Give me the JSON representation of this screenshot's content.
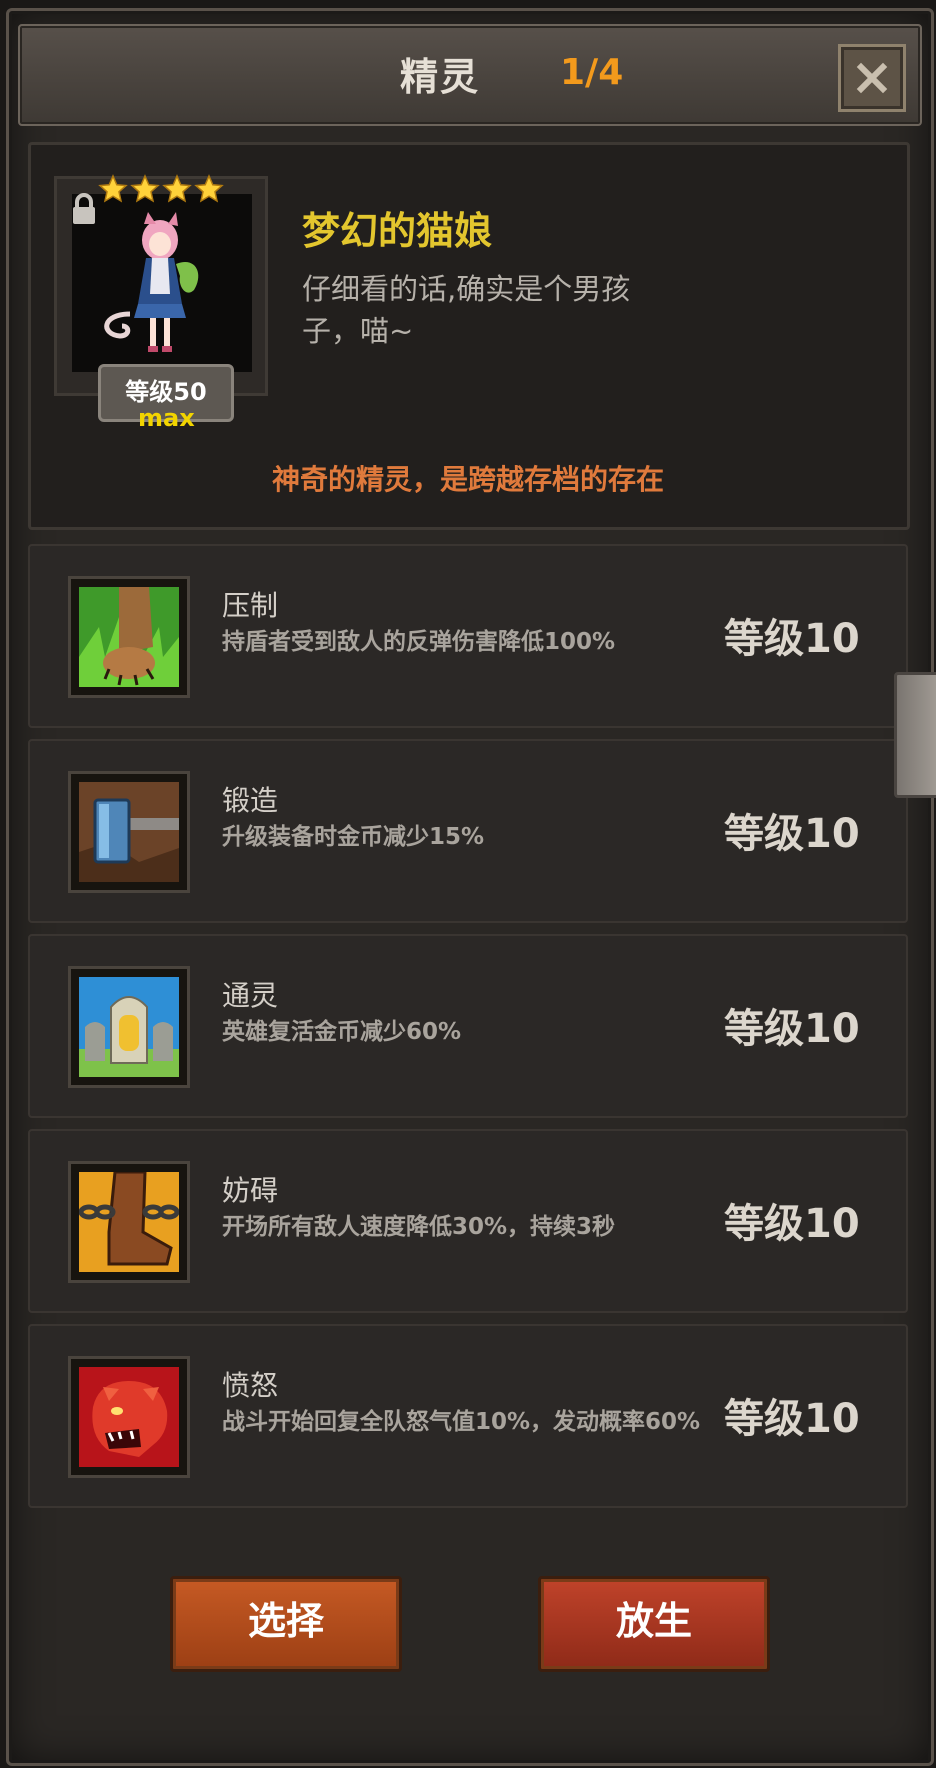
{
  "header": {
    "title": "精灵",
    "page_indicator": "1/4"
  },
  "spirit": {
    "name": "梦幻的猫娘",
    "description": "仔细看的话,确实是个男孩子，喵~",
    "stars": 4,
    "level_label": "等级50",
    "max_label": "max",
    "note": "神奇的精灵，是跨越存档的存在"
  },
  "skills": [
    {
      "name": "压制",
      "description": "持盾者受到敌人的反弹伤害降低100%",
      "level": "等级10",
      "icon": "lion-paw-icon"
    },
    {
      "name": "锻造",
      "description": "升级装备时金币减少15%",
      "level": "等级10",
      "icon": "hammer-icon"
    },
    {
      "name": "通灵",
      "description": "英雄复活金币减少60%",
      "level": "等级10",
      "icon": "tombstone-icon"
    },
    {
      "name": "妨碍",
      "description": "开场所有敌人速度降低30%，持续3秒",
      "level": "等级10",
      "icon": "chained-boot-icon"
    },
    {
      "name": "愤怒",
      "description": "战斗开始回复全队怒气值10%，发动概率60%",
      "level": "等级10",
      "icon": "panther-head-icon"
    }
  ],
  "buttons": {
    "select": "选择",
    "release": "放生"
  },
  "colors": {
    "accent_orange": "#f39a1c",
    "name_gold": "#e3c62e",
    "note_orange": "#e07a3c"
  }
}
